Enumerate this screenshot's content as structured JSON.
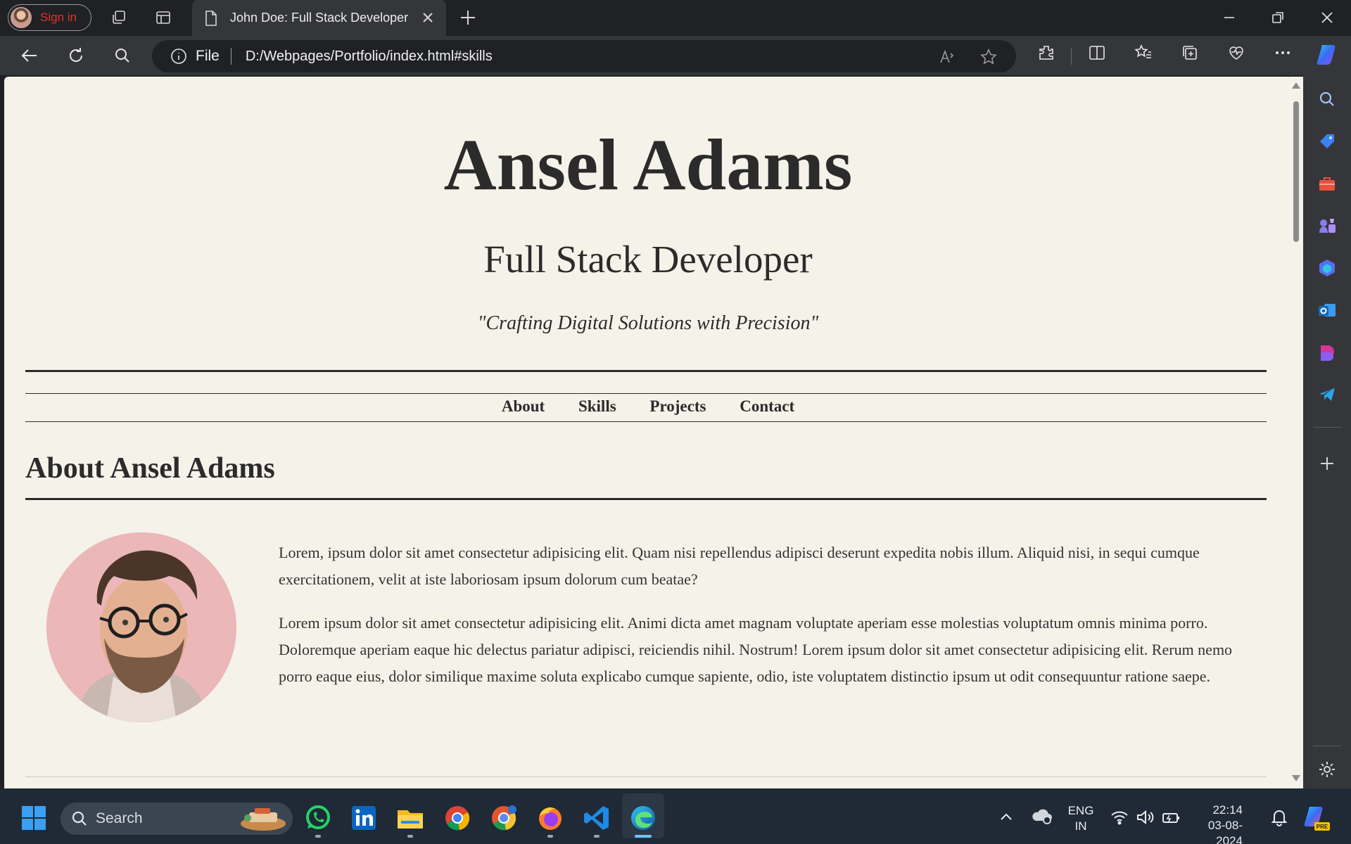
{
  "browser": {
    "profile_label": "Sign in",
    "tab_title": "John Doe: Full Stack Developer",
    "address_scheme": "File",
    "address_url": "D:/Webpages/Portfolio/index.html#skills",
    "accent": "#1a73e8"
  },
  "site": {
    "name": "Ansel Adams",
    "role": "Full Stack Developer",
    "tagline": "\"Crafting Digital Solutions with Precision\"",
    "nav": [
      "About",
      "Skills",
      "Projects",
      "Contact"
    ],
    "about_heading": "About Ansel Adams",
    "paragraphs": [
      "Lorem, ipsum dolor sit amet consectetur adipisicing elit. Quam nisi repellendus adipisci deserunt expedita nobis illum. Aliquid nisi, in sequi cumque exercitationem, velit at iste laboriosam ipsum dolorum cum beatae?",
      "Lorem ipsum dolor sit amet consectetur adipisicing elit. Animi dicta amet magnam voluptate aperiam esse molestias voluptatum omnis minima porro. Doloremque aperiam eaque hic delectus pariatur adipisci, reiciendis nihil. Nostrum! Lorem ipsum dolor sit amet consectetur adipisicing elit. Rerum nemo porro eaque eius, dolor similique maxime soluta explicabo cumque sapiente, odio, iste voluptatem distinctio ipsum ut odit consequuntur ratione saepe."
    ],
    "bg_color": "#f5f2e9",
    "text_color": "#2b2b2b"
  },
  "taskbar": {
    "search_placeholder": "Search",
    "lang_line1": "ENG",
    "lang_line2": "IN",
    "time": "22:14",
    "date": "03-08-2024"
  },
  "icons": {
    "toolbar": [
      "back-icon",
      "refresh-icon",
      "search-icon",
      "info-icon",
      "read-aloud-icon",
      "favorite-icon",
      "extensions-icon",
      "split-screen-icon",
      "favorites-icon",
      "collections-icon",
      "browser-essentials-icon",
      "more-icon",
      "copilot-icon"
    ],
    "sidebar": [
      "search-icon",
      "shopping-icon",
      "tools-icon",
      "games-icon",
      "microsoft-365-icon",
      "outlook-icon",
      "designer-icon",
      "telegram-icon",
      "add-icon",
      "settings-icon"
    ],
    "taskbar": [
      "windows-start-icon",
      "whatsapp-icon",
      "linkedin-icon",
      "file-explorer-icon",
      "chrome-icon",
      "chrome-canary-icon",
      "firefox-icon",
      "vscode-icon",
      "edge-icon"
    ]
  }
}
